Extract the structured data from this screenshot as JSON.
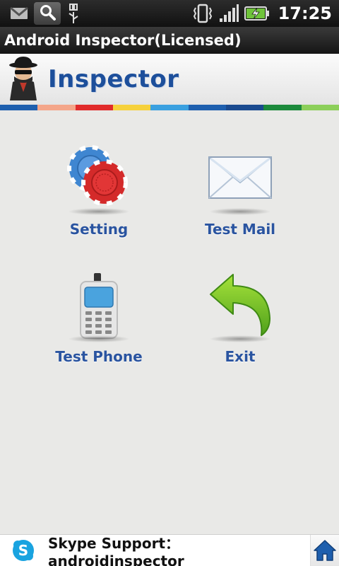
{
  "status_bar": {
    "icons": [
      "gmail-icon",
      "search-icon",
      "usb-icon",
      "vibrate-icon",
      "signal-icon",
      "battery-icon"
    ],
    "time": "17:25"
  },
  "title_bar": {
    "title": "Android Inspector(Licensed)"
  },
  "header": {
    "logo_text": "Inspector"
  },
  "stripe_colors": [
    "#1e5fae",
    "#f4a68a",
    "#e12b2b",
    "#f6d13c",
    "#3aa0e0",
    "#1e5fae",
    "#1a4a8f",
    "#1c8a3c",
    "#8ccf5a"
  ],
  "menu": {
    "items": [
      {
        "label": "Setting",
        "icon": "poker-chips-icon"
      },
      {
        "label": "Test Mail",
        "icon": "envelope-icon"
      },
      {
        "label": "Test Phone",
        "icon": "phone-icon"
      },
      {
        "label": "Exit",
        "icon": "back-arrow-icon"
      }
    ]
  },
  "footer": {
    "text": "Skype Support：androidinspector",
    "icon": "skype-icon",
    "home_icon": "home-icon"
  },
  "colors": {
    "label_blue": "#2a54a0",
    "logo_blue": "#1d4f9b",
    "background": "#e9e9e7"
  }
}
